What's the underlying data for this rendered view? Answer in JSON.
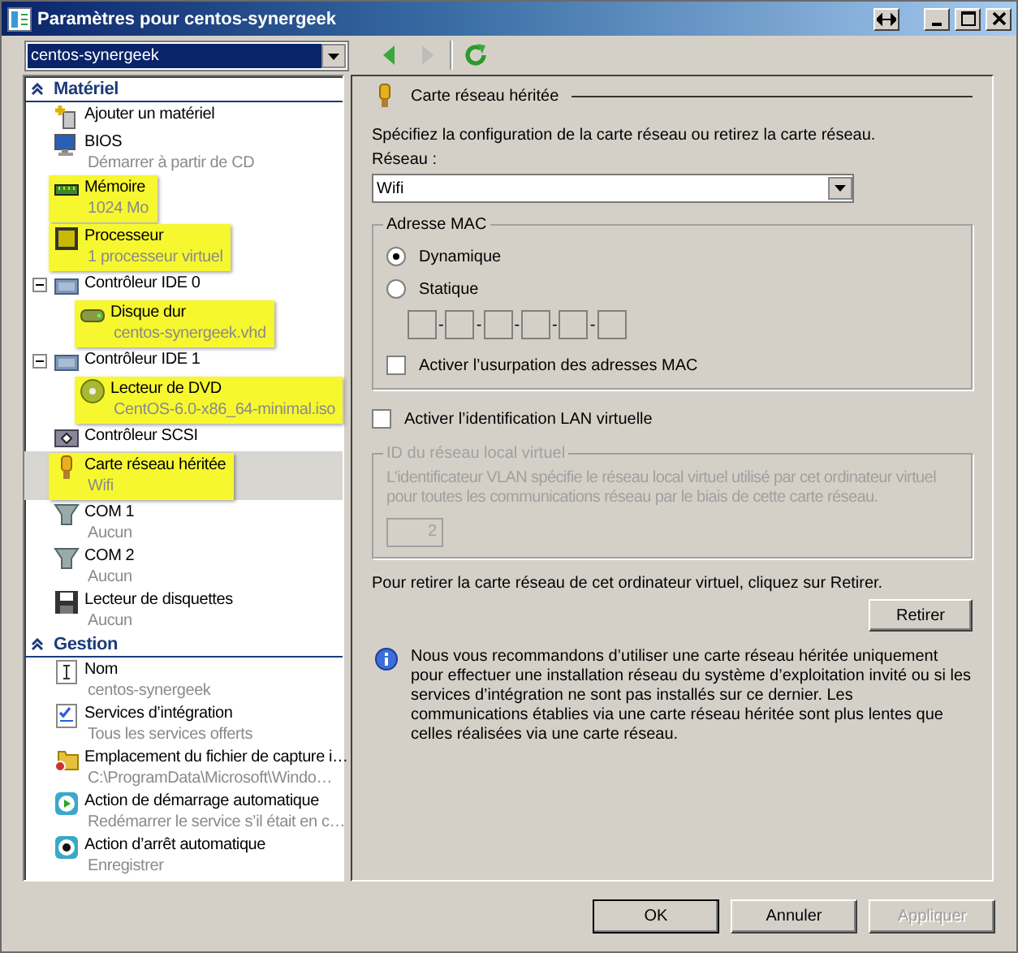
{
  "window": {
    "title": "Paramètres pour centos-synergeek"
  },
  "vm_selector": {
    "value": "centos-synergeek"
  },
  "toolbar": {
    "buttons": [
      {
        "disabled": false
      },
      {
        "disabled": true
      },
      {
        "disabled": false
      }
    ]
  },
  "sidebar": {
    "sections": [
      {
        "title": "Matériel",
        "expanded": true,
        "items": [
          {
            "label": "Ajouter un matériel",
            "highlighted": false,
            "selected": false
          },
          {
            "label": "BIOS",
            "detail": "Démarrer à partir de CD",
            "highlighted": false,
            "selected": false
          },
          {
            "label": "Mémoire",
            "detail": "1024 Mo",
            "highlighted": true,
            "selected": false
          },
          {
            "label": "Processeur",
            "detail": "1 processeur virtuel",
            "highlighted": true,
            "selected": false
          },
          {
            "label": "Contrôleur IDE 0",
            "highlighted": false,
            "selected": false,
            "expanded": true,
            "children": [
              {
                "label": "Disque dur",
                "detail": "centos-synergeek.vhd",
                "highlighted": true,
                "selected": false
              }
            ]
          },
          {
            "label": "Contrôleur IDE 1",
            "highlighted": false,
            "selected": false,
            "expanded": true,
            "children": [
              {
                "label": "Lecteur de DVD",
                "detail": "CentOS-6.0-x86_64-minimal.iso",
                "highlighted": true,
                "selected": false
              }
            ]
          },
          {
            "label": "Contrôleur SCSI",
            "highlighted": false,
            "selected": false
          },
          {
            "label": "Carte réseau héritée",
            "detail": "Wifi",
            "highlighted": true,
            "selected": true
          },
          {
            "label": "COM 1",
            "detail": "Aucun",
            "highlighted": false,
            "selected": false
          },
          {
            "label": "COM 2",
            "detail": "Aucun",
            "highlighted": false,
            "selected": false
          },
          {
            "label": "Lecteur de disquettes",
            "detail": "Aucun",
            "highlighted": false,
            "selected": false
          }
        ]
      },
      {
        "title": "Gestion",
        "expanded": true,
        "items": [
          {
            "label": "Nom",
            "detail": "centos-synergeek",
            "highlighted": false,
            "selected": false
          },
          {
            "label": "Services d’intégration",
            "detail": "Tous les services offerts",
            "highlighted": false,
            "selected": false
          },
          {
            "label": "Emplacement du fichier de capture i…",
            "detail": "C:\\ProgramData\\Microsoft\\Windo…",
            "highlighted": false,
            "selected": false
          },
          {
            "label": "Action de démarrage automatique",
            "detail": "Redémarrer le service s’il était en c…",
            "highlighted": false,
            "selected": false
          },
          {
            "label": "Action d’arrêt automatique",
            "detail": "Enregistrer",
            "highlighted": false,
            "selected": false
          }
        ]
      }
    ]
  },
  "panel": {
    "title": "Carte réseau héritée",
    "intro": "Spécifiez la configuration de la carte réseau ou retirez la carte réseau.",
    "network": {
      "label": "Réseau :",
      "value": "Wifi"
    },
    "mac_group": {
      "title": "Adresse MAC",
      "options": [
        {
          "label": "Dynamique",
          "selected": true
        },
        {
          "label": "Statique",
          "selected": false
        }
      ],
      "separators": [
        "-",
        "-",
        "-",
        "-",
        "-"
      ],
      "spoofing": {
        "label": "Activer l’usurpation des adresses MAC",
        "checked": false
      }
    },
    "vlan": {
      "label": "Activer l’identification LAN virtuelle",
      "checked": false
    },
    "vlan_group": {
      "title": "ID du réseau local virtuel",
      "description": "L’identificateur VLAN spécifie le réseau local virtuel utilisé par cet ordinateur virtuel pour toutes les communications réseau par le biais de cette carte réseau.",
      "value": "2",
      "disabled": true
    },
    "remove_text": "Pour retirer la carte réseau de cet ordinateur virtuel, cliquez sur Retirer.",
    "remove_button": "Retirer",
    "info": "Nous vous recommandons d’utiliser une carte réseau héritée uniquement pour effectuer une installation réseau du système d’exploitation invité ou si les services d’intégration ne sont pas installés sur ce dernier. Les communications établies via une carte réseau héritée sont plus lentes que celles réalisées via une carte réseau."
  },
  "buttons": [
    {
      "label": "OK",
      "default": true,
      "disabled": false
    },
    {
      "label": "Annuler",
      "default": false,
      "disabled": false
    },
    {
      "label": "Appliquer",
      "default": false,
      "disabled": true
    }
  ]
}
